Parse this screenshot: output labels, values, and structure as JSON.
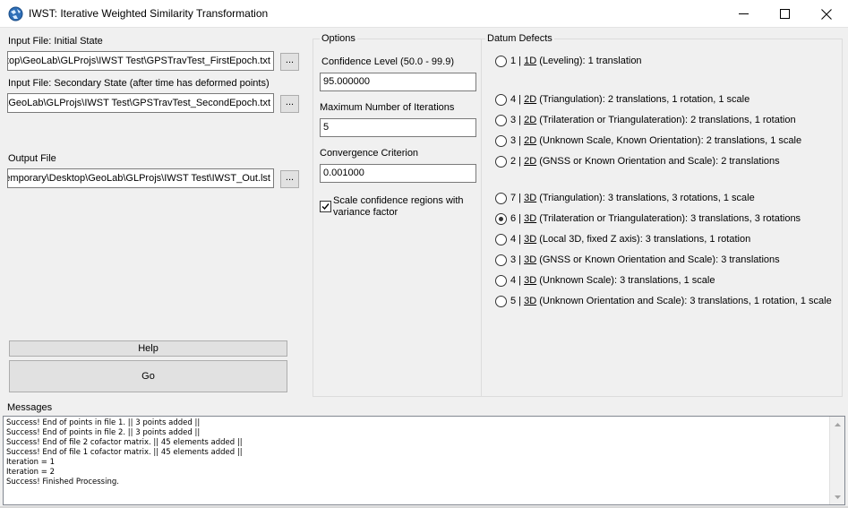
{
  "window": {
    "title": "IWST: Iterative Weighted Similarity Transformation",
    "controls": {
      "minimize": "minimize-icon",
      "maximize": "maximize-icon",
      "close": "close-icon"
    }
  },
  "files": {
    "initial_label": "Input File: Initial State",
    "initial_value": "C:\\Users\\Desktop\\GeoLab\\GLProjs\\IWST Test\\GPSTravTest_FirstEpoch.txt",
    "secondary_label": "Input File: Secondary State (after time has deformed points)",
    "secondary_value": "C:\\Users\\Desktop\\GeoLab\\GLProjs\\IWST Test\\GPSTravTest_SecondEpoch.txt",
    "output_label": "Output File",
    "output_value": "C:\\Temporary\\Desktop\\GeoLab\\GLProjs\\IWST Test\\IWST_Out.lst",
    "browse_label": "..."
  },
  "buttons": {
    "help": "Help",
    "go": "Go"
  },
  "options": {
    "group_title": "Options",
    "confidence_label": "Confidence Level (50.0 - 99.9)",
    "confidence_value": "95.000000",
    "iterations_label": "Maximum Number of Iterations",
    "iterations_value": "5",
    "convergence_label": "Convergence Criterion",
    "convergence_value": "0.001000",
    "scale_checkbox_line1": "Scale confidence regions with",
    "scale_checkbox_line2": "variance factor",
    "scale_checked": true
  },
  "datum_defects": {
    "group_title": "Datum Defects",
    "items": [
      {
        "prefix": "1 | ",
        "dim": "1D",
        "text": " (Leveling): 1 translation",
        "selected": false
      },
      {
        "prefix": "4 | ",
        "dim": "2D",
        "text": " (Triangulation): 2 translations, 1 rotation, 1 scale",
        "selected": false
      },
      {
        "prefix": "3 | ",
        "dim": "2D",
        "text": " (Trilateration or Triangulateration): 2 translations, 1 rotation",
        "selected": false
      },
      {
        "prefix": "3 | ",
        "dim": "2D",
        "text": " (Unknown Scale, Known Orientation): 2 translations, 1 scale",
        "selected": false
      },
      {
        "prefix": "2 | ",
        "dim": "2D",
        "text": " (GNSS or Known Orientation and Scale): 2 translations",
        "selected": false
      },
      {
        "prefix": "7 | ",
        "dim": "3D",
        "text": " (Triangulation): 3 translations, 3 rotations, 1 scale",
        "selected": false
      },
      {
        "prefix": "6 | ",
        "dim": "3D",
        "text": " (Trilateration or Triangulateration): 3 translations, 3 rotations",
        "selected": true
      },
      {
        "prefix": "4 | ",
        "dim": "3D",
        "text": " (Local 3D, fixed Z axis): 3 translations, 1 rotation",
        "selected": false
      },
      {
        "prefix": "3 | ",
        "dim": "3D",
        "text": " (GNSS or Known Orientation and Scale): 3 translations",
        "selected": false
      },
      {
        "prefix": "4 | ",
        "dim": "3D",
        "text": " (Unknown Scale): 3 translations, 1 scale",
        "selected": false
      },
      {
        "prefix": "5 | ",
        "dim": "3D",
        "text": " (Unknown Orientation and Scale): 3 translations, 1 rotation, 1 scale",
        "selected": false
      }
    ]
  },
  "messages": {
    "label": "Messages",
    "lines": [
      "Success! End of points in file 1. || 3 points added ||",
      "Success! End of points in file 2. || 3 points added ||",
      "Success! End of file 2 cofactor matrix. || 45 elements added ||",
      "Success! End of file 1 cofactor matrix. || 45 elements added ||",
      "Iteration = 1",
      "Iteration = 2",
      "Success! Finished Processing."
    ]
  }
}
